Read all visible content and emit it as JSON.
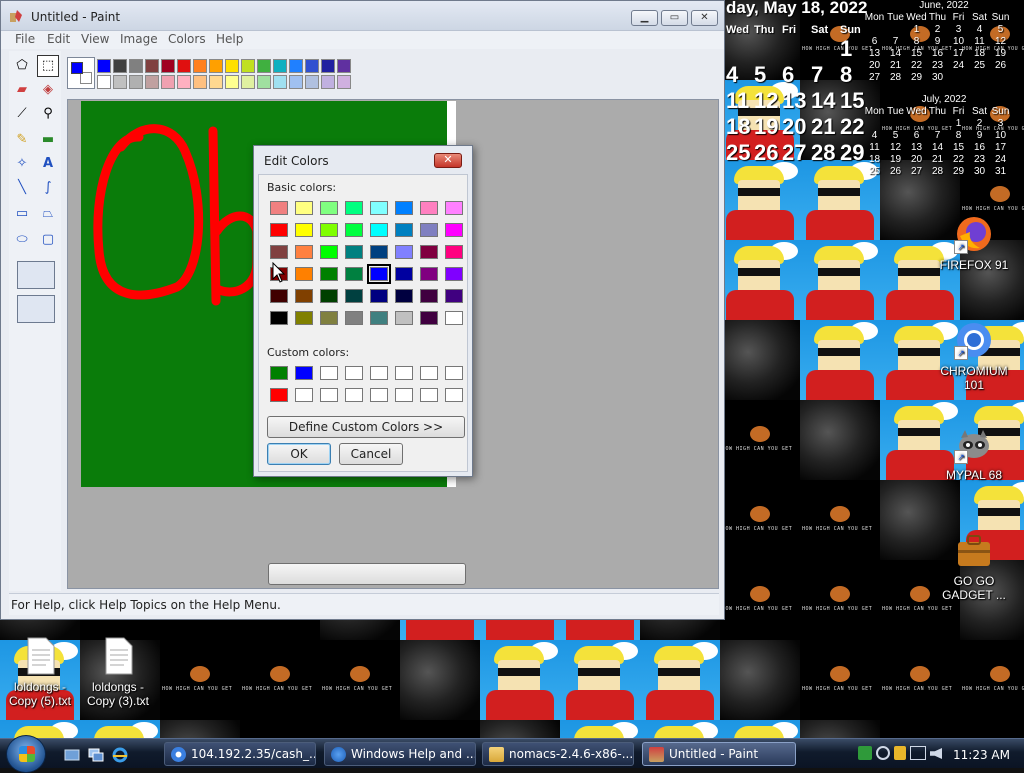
{
  "paint": {
    "title": "Untitled - Paint",
    "menu": [
      "File",
      "Edit",
      "View",
      "Image",
      "Colors",
      "Help"
    ],
    "status": "For Help, click Help Topics on the Help Menu.",
    "primary_color": "#0000ff",
    "secondary_color": "#ffffff",
    "canvas_color": "#0a7c0a",
    "drawing_color": "#ff0000",
    "palette": [
      "#0000ff",
      "#404040",
      "#808080",
      "#804040",
      "#a00020",
      "#e01010",
      "#ff8020",
      "#ffa000",
      "#ffe000",
      "#c0e020",
      "#40b040",
      "#10b0c0",
      "#2080ff",
      "#3050d0",
      "#2020a0",
      "#6030a0",
      "#ffffff",
      "#c0c0c0",
      "#b0b0b0",
      "#c0a0a0",
      "#f0a0b0",
      "#ffb0c0",
      "#ffc080",
      "#ffd890",
      "#ffff90",
      "#e0f0a0",
      "#a0e0a0",
      "#a0e0f0",
      "#a0c0f0",
      "#b0c0e0",
      "#c0b0e0",
      "#d0b0e0"
    ]
  },
  "dialog": {
    "title": "Edit Colors",
    "close": "✕",
    "basic_label": "Basic colors:",
    "custom_label": "Custom colors:",
    "define_button": "Define Custom Colors >>",
    "ok": "OK",
    "cancel": "Cancel",
    "basic_colors": [
      "#f08080",
      "#ffff80",
      "#80ff80",
      "#00ff80",
      "#80ffff",
      "#0080ff",
      "#ff80c0",
      "#ff80ff",
      "#ff0000",
      "#ffff00",
      "#80ff00",
      "#00ff40",
      "#00ffff",
      "#0080c0",
      "#8080c0",
      "#ff00ff",
      "#804040",
      "#ff8040",
      "#00ff00",
      "#008080",
      "#004080",
      "#8080ff",
      "#800040",
      "#ff0080",
      "#800000",
      "#ff8000",
      "#008000",
      "#008040",
      "#0000ff",
      "#0000a0",
      "#800080",
      "#8000ff",
      "#400000",
      "#804000",
      "#004000",
      "#004040",
      "#000080",
      "#000040",
      "#400040",
      "#400080",
      "#000000",
      "#808000",
      "#808040",
      "#808080",
      "#408080",
      "#c0c0c0",
      "#400040",
      "#ffffff"
    ],
    "selected_basic_index": 28,
    "custom_colors": [
      "#008000",
      "#0000ff",
      "#ffffff",
      "#ffffff",
      "#ffffff",
      "#ffffff",
      "#ffffff",
      "#ffffff",
      "#ff0000",
      "#ffffff",
      "#ffffff",
      "#ffffff",
      "#ffffff",
      "#ffffff",
      "#ffffff",
      "#ffffff"
    ]
  },
  "desktop": {
    "date_text": "day, May 18, 2022",
    "week_headers": [
      "Wed",
      "Thu",
      "Fri",
      "Sat",
      "Sun"
    ],
    "big_dates": [
      [
        "",
        "",
        "",
        "",
        "1"
      ],
      [
        "4",
        "5",
        "6",
        "7",
        "8"
      ],
      [
        "11",
        "12",
        "13",
        "14",
        "15"
      ],
      [
        "18",
        "19",
        "20",
        "21",
        "22"
      ],
      [
        "25",
        "26",
        "27",
        "28",
        "29"
      ]
    ],
    "june": {
      "title": "June, 2022",
      "head": [
        "Mon",
        "Tue",
        "Wed",
        "Thu",
        "Fri",
        "Sat",
        "Sun"
      ],
      "rows": [
        [
          "",
          "",
          "1",
          "2",
          "3",
          "4",
          "5"
        ],
        [
          "6",
          "7",
          "8",
          "9",
          "10",
          "11",
          "12"
        ],
        [
          "13",
          "14",
          "15",
          "16",
          "17",
          "18",
          "19"
        ],
        [
          "20",
          "21",
          "22",
          "23",
          "24",
          "25",
          "26"
        ],
        [
          "27",
          "28",
          "29",
          "30",
          "",
          "",
          ""
        ]
      ]
    },
    "july": {
      "title": "July, 2022",
      "head": [
        "Mon",
        "Tue",
        "Wed",
        "Thu",
        "Fri",
        "Sat",
        "Sun"
      ],
      "rows": [
        [
          "",
          "",
          "",
          "",
          "1",
          "2",
          "3"
        ],
        [
          "4",
          "5",
          "6",
          "7",
          "8",
          "9",
          "10"
        ],
        [
          "11",
          "12",
          "13",
          "14",
          "15",
          "16",
          "17"
        ],
        [
          "18",
          "19",
          "20",
          "21",
          "22",
          "23",
          "24"
        ],
        [
          "25",
          "26",
          "27",
          "28",
          "29",
          "30",
          "31"
        ]
      ]
    },
    "icons": [
      {
        "name": "firefox",
        "label": "FIREFOX 91"
      },
      {
        "name": "chromium",
        "label": "CHROMIUM 101"
      },
      {
        "name": "mypal",
        "label": "MYPAL 68"
      },
      {
        "name": "gogo",
        "label": "GO GO GADGET ..."
      },
      {
        "name": "file1",
        "label": "loldongs - Copy (5).txt"
      },
      {
        "name": "file2",
        "label": "loldongs - Copy (3).txt"
      }
    ],
    "banner_text": "HOW HIGH CAN YOU GET"
  },
  "taskbar": {
    "items": [
      {
        "label": "104.192.2.35/cash_...",
        "icon": "chromium-icon"
      },
      {
        "label": "Windows Help and ...",
        "icon": "help-icon"
      },
      {
        "label": "nomacs-2.4.6-x86-...",
        "icon": "folder-icon"
      },
      {
        "label": "Untitled - Paint",
        "icon": "paint-icon"
      }
    ],
    "clock": "11:23 AM"
  }
}
